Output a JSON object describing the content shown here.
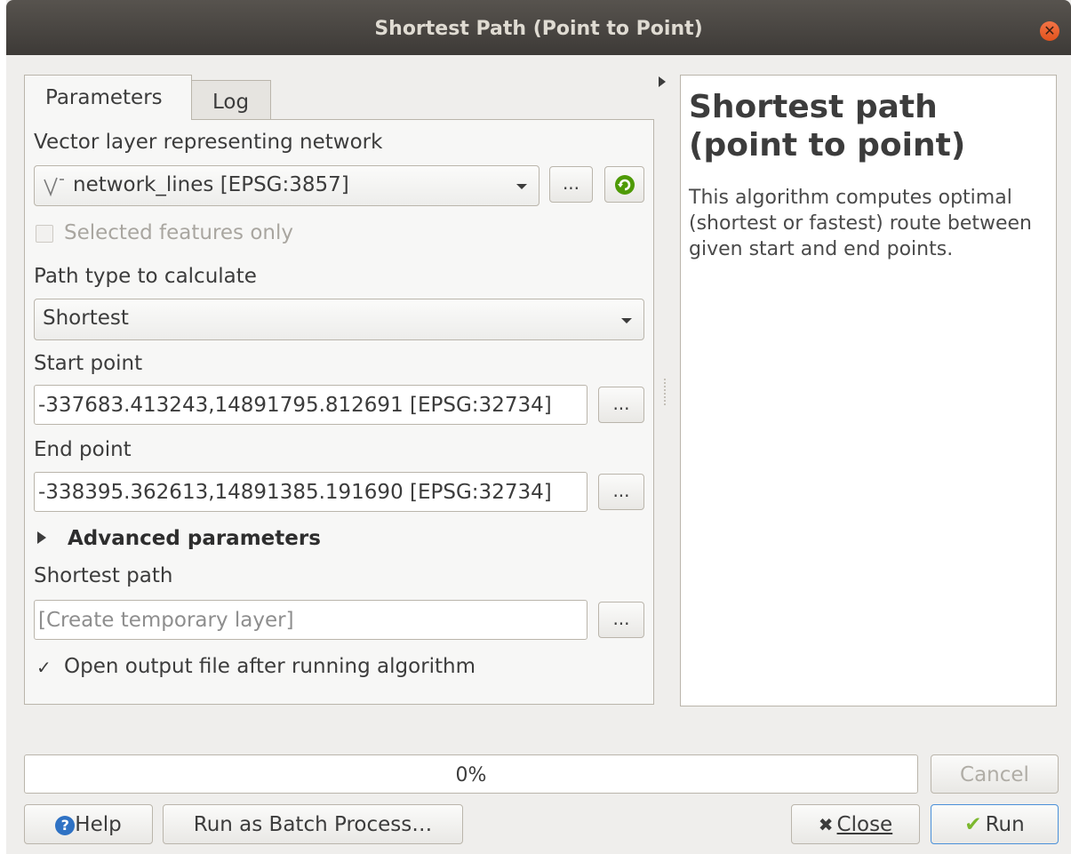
{
  "window": {
    "title": "Shortest Path (Point to Point)"
  },
  "tabs": [
    {
      "label": "Parameters",
      "active": true
    },
    {
      "label": "Log",
      "active": false
    }
  ],
  "params": {
    "network_label": "Vector layer representing network",
    "network_value": "network_lines [EPSG:3857]",
    "network_icon": "line-layer-icon",
    "selected_only_label": "Selected features only",
    "selected_only_checked": false,
    "path_type_label": "Path type to calculate",
    "path_type_value": "Shortest",
    "start_label": "Start point",
    "start_value": "-337683.413243,14891795.812691 [EPSG:32734]",
    "end_label": "End point",
    "end_value": "-338395.362613,14891385.191690 [EPSG:32734]",
    "advanced_label": "Advanced parameters",
    "output_label": "Shortest path",
    "output_placeholder": "[Create temporary layer]",
    "open_output_label": "Open output file after running algorithm",
    "open_output_checked": true,
    "browse_label": "..."
  },
  "help": {
    "title": "Shortest path (point to point)",
    "body": "This algorithm computes optimal (shortest or fastest) route between given start and end points."
  },
  "progress": {
    "value": 0,
    "text": "0%"
  },
  "buttons": {
    "cancel": "Cancel",
    "help": "Help",
    "batch": "Run as Batch Process…",
    "close": "Close",
    "run": "Run"
  },
  "colors": {
    "accent": "#f07746",
    "help_icon": "#2f72c4",
    "run_check": "#7cb82f",
    "refresh_icon": "#4e9a06"
  }
}
